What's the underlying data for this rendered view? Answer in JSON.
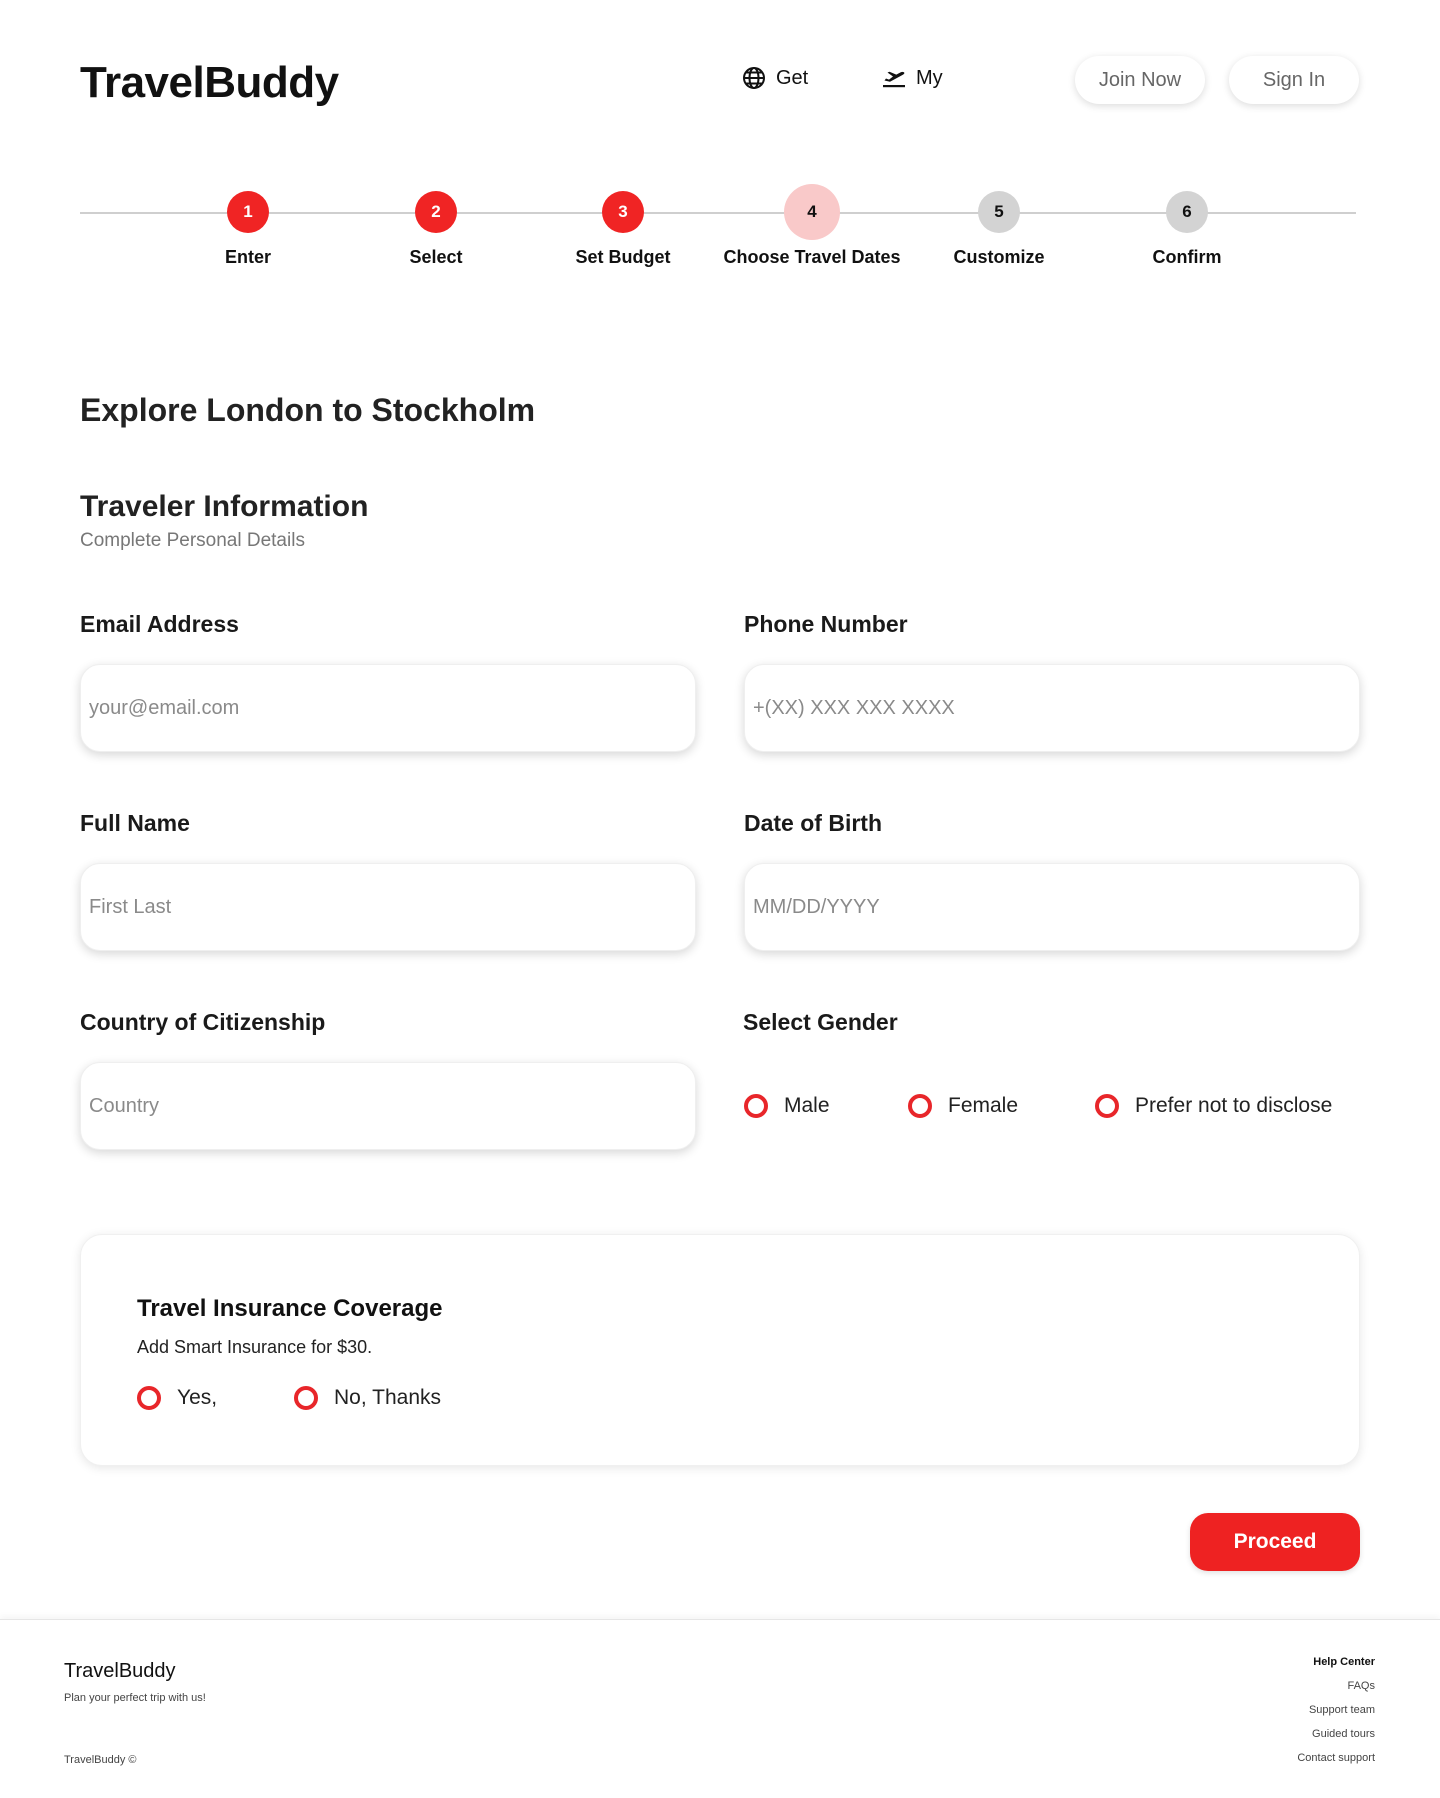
{
  "header": {
    "logo": "TravelBuddy",
    "nav": [
      {
        "label": "Get",
        "icon": "globe-icon"
      },
      {
        "label": "My",
        "icon": "airplane-takeoff-icon"
      }
    ],
    "join_label": "Join Now",
    "signin_label": "Sign In"
  },
  "stepper": {
    "steps": [
      {
        "number": "1",
        "label": "Enter",
        "state": "done"
      },
      {
        "number": "2",
        "label": "Select",
        "state": "done"
      },
      {
        "number": "3",
        "label": "Set Budget",
        "state": "done"
      },
      {
        "number": "4",
        "label": "Choose Travel Dates",
        "state": "current"
      },
      {
        "number": "5",
        "label": "Customize",
        "state": "todo"
      },
      {
        "number": "6",
        "label": "Confirm",
        "state": "todo"
      }
    ]
  },
  "page": {
    "title": "Explore London to Stockholm",
    "section_title": "Traveler Information",
    "section_subtitle": "Complete Personal Details"
  },
  "form": {
    "email": {
      "label": "Email Address",
      "placeholder": "your@email.com"
    },
    "phone": {
      "label": "Phone Number",
      "placeholder": "+(XX) XXX XXX XXXX"
    },
    "name": {
      "label": "Full Name",
      "placeholder": "First Last"
    },
    "dob": {
      "label": "Date of Birth",
      "placeholder": "MM/DD/YYYY"
    },
    "country": {
      "label": "Country of Citizenship",
      "placeholder": "Country"
    },
    "gender": {
      "label": "Select Gender",
      "options": [
        "Male",
        "Female",
        "Prefer not to disclose"
      ]
    }
  },
  "insurance": {
    "title": "Travel Insurance Coverage",
    "text": "Add Smart Insurance for $30.",
    "options": [
      "Yes,",
      "No, Thanks"
    ]
  },
  "actions": {
    "proceed_label": "Proceed"
  },
  "footer": {
    "brand": "TravelBuddy",
    "tagline": "Plan your perfect trip with us!",
    "copyright": "TravelBuddy ©",
    "links_heading": "Help Center",
    "links": [
      "FAQs",
      "Support team",
      "Guided tours",
      "Contact support"
    ]
  },
  "colors": {
    "accent": "#ee2222",
    "step_current": "#f9c9c9",
    "step_todo": "#d3d3d3"
  }
}
